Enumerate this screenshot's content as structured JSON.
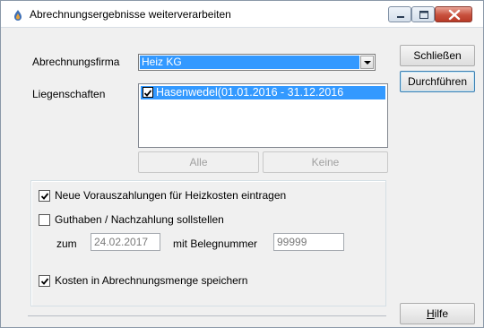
{
  "window": {
    "title": "Abrechnungsergebnisse weiterverarbeiten"
  },
  "form": {
    "firma_label": "Abrechnungsfirma",
    "firma_value": "Heiz KG",
    "liegenschaften_label": "Liegenschaften",
    "liegenschaften_items": [
      {
        "checked": true,
        "label": "Hasenwedel(01.01.2016 - 31.12.2016"
      }
    ],
    "alle_button": "Alle",
    "keine_button": "Keine"
  },
  "options": {
    "vorauszahlungen_label": "Neue Vorauszahlungen für Heizkosten eintragen",
    "vorauszahlungen_checked": true,
    "guthaben_label": "Guthaben / Nachzahlung sollstellen",
    "guthaben_checked": false,
    "zum_label": "zum",
    "zum_value": "24.02.2017",
    "beleg_label": "mit Belegnummer",
    "beleg_value": "99999",
    "kosten_label": "Kosten in Abrechnungsmenge speichern",
    "kosten_checked": true
  },
  "actions": {
    "schliessen": "Schließen",
    "durchfuehren": "Durchführen",
    "hilfe_rest": "ilfe",
    "hilfe_accel": "H"
  }
}
